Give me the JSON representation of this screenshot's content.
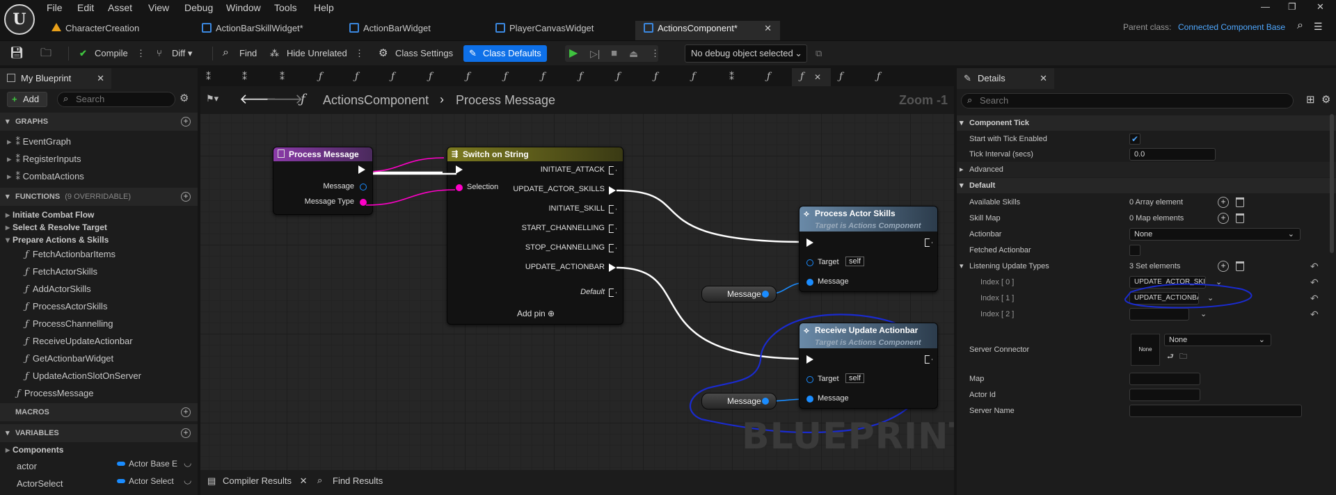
{
  "menu": {
    "items": [
      "File",
      "Edit",
      "Asset",
      "View",
      "Debug",
      "Window",
      "Tools",
      "Help"
    ]
  },
  "tabs": [
    {
      "label": "CharacterCreation"
    },
    {
      "label": "ActionBarSkillWidget*"
    },
    {
      "label": "ActionBarWidget"
    },
    {
      "label": "PlayerCanvasWidget"
    },
    {
      "label": "ActionsComponent*"
    }
  ],
  "parent_class": {
    "label": "Parent class:",
    "value": "Connected Component Base"
  },
  "toolbar": {
    "compile": "Compile",
    "diff": "Diff",
    "find": "Find",
    "hide_unrelated": "Hide Unrelated",
    "class_settings": "Class Settings",
    "class_defaults": "Class Defaults",
    "debug_object": "No debug object selected"
  },
  "my_blueprint": {
    "title": "My Blueprint",
    "add": "Add",
    "search_placeholder": "Search",
    "graphs_header": "GRAPHS",
    "graphs": [
      "EventGraph",
      "RegisterInputs",
      "CombatActions"
    ],
    "functions_header": "FUNCTIONS",
    "functions_count": "(9 OVERRIDABLE)",
    "function_groups": [
      "Initiate Combat Flow",
      "Select & Resolve Target",
      "Prepare Actions & Skills"
    ],
    "functions": [
      "FetchActionbarItems",
      "FetchActorSkills",
      "AddActorSkills",
      "ProcessActorSkills",
      "ProcessChannelling",
      "ReceiveUpdateActionbar",
      "GetActionbarWidget",
      "UpdateActionSlotOnServer"
    ],
    "process_message": "ProcessMessage",
    "macros_header": "MACROS",
    "variables_header": "VARIABLES",
    "components": "Components",
    "variables": [
      {
        "name": "actor",
        "type": "Actor Base E"
      },
      {
        "name": "ActorSelect",
        "type": "Actor Select"
      }
    ]
  },
  "graph": {
    "breadcrumb_root": "ActionsComponent",
    "breadcrumb_leaf": "Process Message",
    "zoom": "Zoom -1",
    "watermark": "BLUEPRINT",
    "process_message_node": {
      "title": "Process Message",
      "pins": [
        "Message",
        "Message Type"
      ]
    },
    "switch_node": {
      "title": "Switch on String",
      "selection": "Selection",
      "outputs": [
        "INITIATE_ATTACK",
        "UPDATE_ACTOR_SKILLS",
        "INITIATE_SKILL",
        "START_CHANNELLING",
        "STOP_CHANNELLING",
        "UPDATE_ACTIONBAR",
        "Default"
      ],
      "add_pin": "Add pin"
    },
    "process_actor_skills": {
      "title": "Process Actor Skills",
      "subtitle": "Target is Actions Component",
      "target": "Target",
      "self": "self",
      "message": "Message"
    },
    "receive_update": {
      "title": "Receive Update Actionbar",
      "subtitle": "Target is Actions Component",
      "target": "Target",
      "self": "self",
      "message": "Message"
    },
    "message_var_1": "Message",
    "message_var_2": "Message"
  },
  "details": {
    "title": "Details",
    "search_placeholder": "Search",
    "component_tick": "Component Tick",
    "start_tick_label": "Start with Tick Enabled",
    "tick_interval_label": "Tick Interval (secs)",
    "tick_interval": "0.0",
    "advanced": "Advanced",
    "default": "Default",
    "available_skills_label": "Available Skills",
    "available_skills": "0 Array element",
    "skill_map_label": "Skill Map",
    "skill_map": "0 Map elements",
    "actionbar_label": "Actionbar",
    "actionbar": "None",
    "fetched_actionbar_label": "Fetched Actionbar",
    "listening_label": "Listening Update Types",
    "listening": "3 Set elements",
    "index0_label": "Index [ 0 ]",
    "index0": "UPDATE_ACTOR_SKILLS",
    "index1_label": "Index [ 1 ]",
    "index1": "UPDATE_ACTIONBAR",
    "index2_label": "Index [ 2 ]",
    "index2": "",
    "server_connector_label": "Server Connector",
    "server_connector_thumb": "None",
    "server_connector": "None",
    "map_label": "Map",
    "actor_id_label": "Actor Id",
    "server_name_label": "Server Name"
  },
  "bottom": {
    "compiler_results": "Compiler Results",
    "find_results": "Find Results"
  },
  "colors": {
    "accent": "#0e70e8",
    "exec": "#ffffff",
    "string_pin": "#ff00c8",
    "object_pin": "#1a8cff",
    "annotation": "#1a2bd0"
  }
}
